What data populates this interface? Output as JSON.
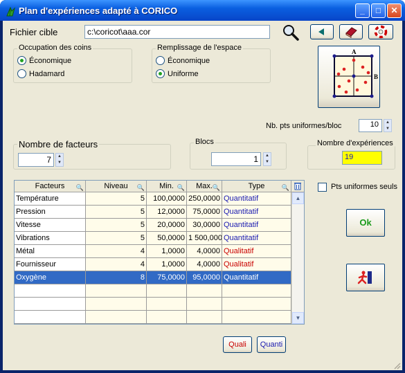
{
  "window": {
    "title": "Plan d'expériences adapté à CORICO"
  },
  "file": {
    "label": "Fichier cible",
    "value": "c:\\coricot\\aaa.cor"
  },
  "occupation": {
    "title": "Occupation des coins",
    "options": [
      "Économique",
      "Hadamard"
    ],
    "selected": 0
  },
  "remplissage": {
    "title": "Remplissage de l'espace",
    "options": [
      "Économique",
      "Uniforme"
    ],
    "selected": 1
  },
  "preview_labels": {
    "a": "A",
    "b": "B"
  },
  "uniform_per_bloc": {
    "label": "Nb. pts uniformes/bloc",
    "value": "10"
  },
  "facteurs_count": {
    "label": "Nombre de facteurs",
    "value": "7"
  },
  "blocs": {
    "label": "Blocs",
    "value": "1"
  },
  "experiences": {
    "label": "Nombre d'expériences",
    "value": "19"
  },
  "uniformes_seuls": {
    "label": "Pts uniformes seuls",
    "checked": false
  },
  "table": {
    "columns": [
      "Facteurs",
      "Niveau",
      "Min.",
      "Max.",
      "Type"
    ],
    "rows": [
      [
        "Température",
        "5",
        "100,0000",
        "250,0000",
        "Quantitatif"
      ],
      [
        "Pression",
        "5",
        "12,0000",
        "75,0000",
        "Quantitatif"
      ],
      [
        "Vitesse",
        "5",
        "20,0000",
        "30,0000",
        "Quantitatif"
      ],
      [
        "Vibrations",
        "5",
        "50,0000",
        "1 500,000",
        "Quantitatif"
      ],
      [
        "Métal",
        "4",
        "1,0000",
        "4,0000",
        "Qualitatif"
      ],
      [
        "Fournisseur",
        "4",
        "1,0000",
        "4,0000",
        "Qualitatif"
      ],
      [
        "Oxygène",
        "8",
        "75,0000",
        "95,0000",
        "Quantitatif"
      ]
    ],
    "selected_row": 6
  },
  "buttons": {
    "ok": "Ok",
    "quali": "Quali",
    "quanti": "Quanti"
  },
  "colors": {
    "quant": "#1a1ab0",
    "qual": "#c80000",
    "highlight": "#ffff00",
    "selection": "#316ac5",
    "ok_text": "#1a9a1a"
  }
}
